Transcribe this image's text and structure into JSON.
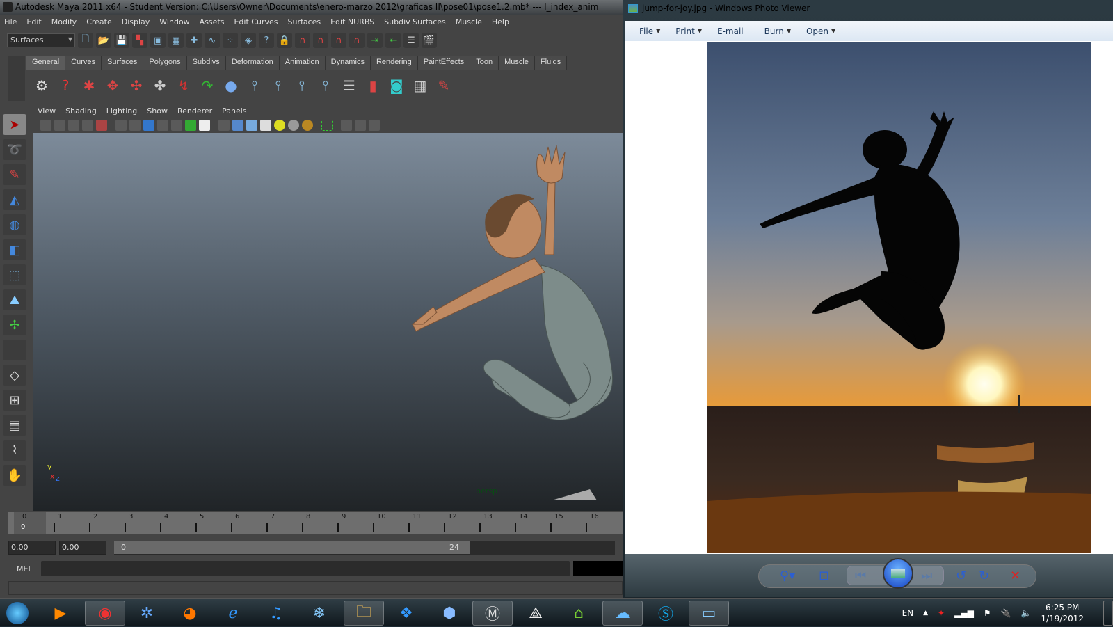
{
  "maya": {
    "title": "Autodesk Maya 2011 x64 - Student Version: C:\\Users\\Owner\\Documents\\enero-marzo 2012\\graficas II\\pose01\\pose1.2.mb*  ---  l_index_anim",
    "menu": [
      "File",
      "Edit",
      "Modify",
      "Create",
      "Display",
      "Window",
      "Assets",
      "Edit Curves",
      "Surfaces",
      "Edit NURBS",
      "Subdiv Surfaces",
      "Muscle",
      "Help"
    ],
    "menu_set": "Surfaces",
    "shelf_tabs": [
      "General",
      "Curves",
      "Surfaces",
      "Polygons",
      "Subdivs",
      "Deformation",
      "Animation",
      "Dynamics",
      "Rendering",
      "PaintEffects",
      "Toon",
      "Muscle",
      "Fluids"
    ],
    "active_shelf_tab": "General",
    "viewport_menu": [
      "View",
      "Shading",
      "Lighting",
      "Show",
      "Renderer",
      "Panels"
    ],
    "camera_label": "persp",
    "axis": {
      "y": "y",
      "x": "x",
      "z": "z"
    },
    "timeline": {
      "ticks": [
        "0",
        "1",
        "2",
        "3",
        "4",
        "5",
        "6",
        "7",
        "8",
        "9",
        "10",
        "11",
        "12",
        "13",
        "14",
        "15",
        "16"
      ],
      "current_frame": "0"
    },
    "range": {
      "start_time": "0.00",
      "start_playback": "0.00",
      "range_start": "0",
      "range_end": "24"
    },
    "mel_label": "MEL",
    "accent_color": "#6a9dd6"
  },
  "photo_viewer": {
    "title": "jump-for-joy.jpg - Windows Photo Viewer",
    "menu": [
      {
        "label": "File",
        "dropdown": true
      },
      {
        "label": "Print",
        "dropdown": true
      },
      {
        "label": "E-mail",
        "dropdown": false
      },
      {
        "label": "Burn",
        "dropdown": true
      },
      {
        "label": "Open",
        "dropdown": true
      }
    ],
    "controls": [
      "zoom-icon",
      "actual-size-icon",
      "previous-icon",
      "slideshow-icon",
      "next-icon",
      "rotate-ccw-icon",
      "rotate-cw-icon",
      "delete-icon"
    ]
  },
  "taskbar": {
    "apps": [
      "start",
      "media-player",
      "chrome",
      "safari",
      "firefox",
      "internet-explorer",
      "itunes",
      "app-snowflake",
      "file-explorer",
      "dropbox",
      "cube-app",
      "maya",
      "unity",
      "home-app",
      "photo-app",
      "skype",
      "photo-viewer"
    ],
    "tray": {
      "language": "EN",
      "time": "6:25 PM",
      "date": "1/19/2012"
    }
  }
}
